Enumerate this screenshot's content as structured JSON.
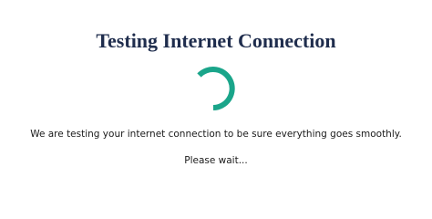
{
  "page": {
    "title": "Testing Internet Connection",
    "message": "We are testing your internet connection to be sure everything goes smoothly.",
    "wait_text": "Please wait...",
    "spinner_icon": "loading-spinner-icon"
  },
  "colors": {
    "title": "#1f2d4d",
    "spinner": "#1aa58a",
    "text": "#1a1a1a",
    "background": "#ffffff"
  }
}
